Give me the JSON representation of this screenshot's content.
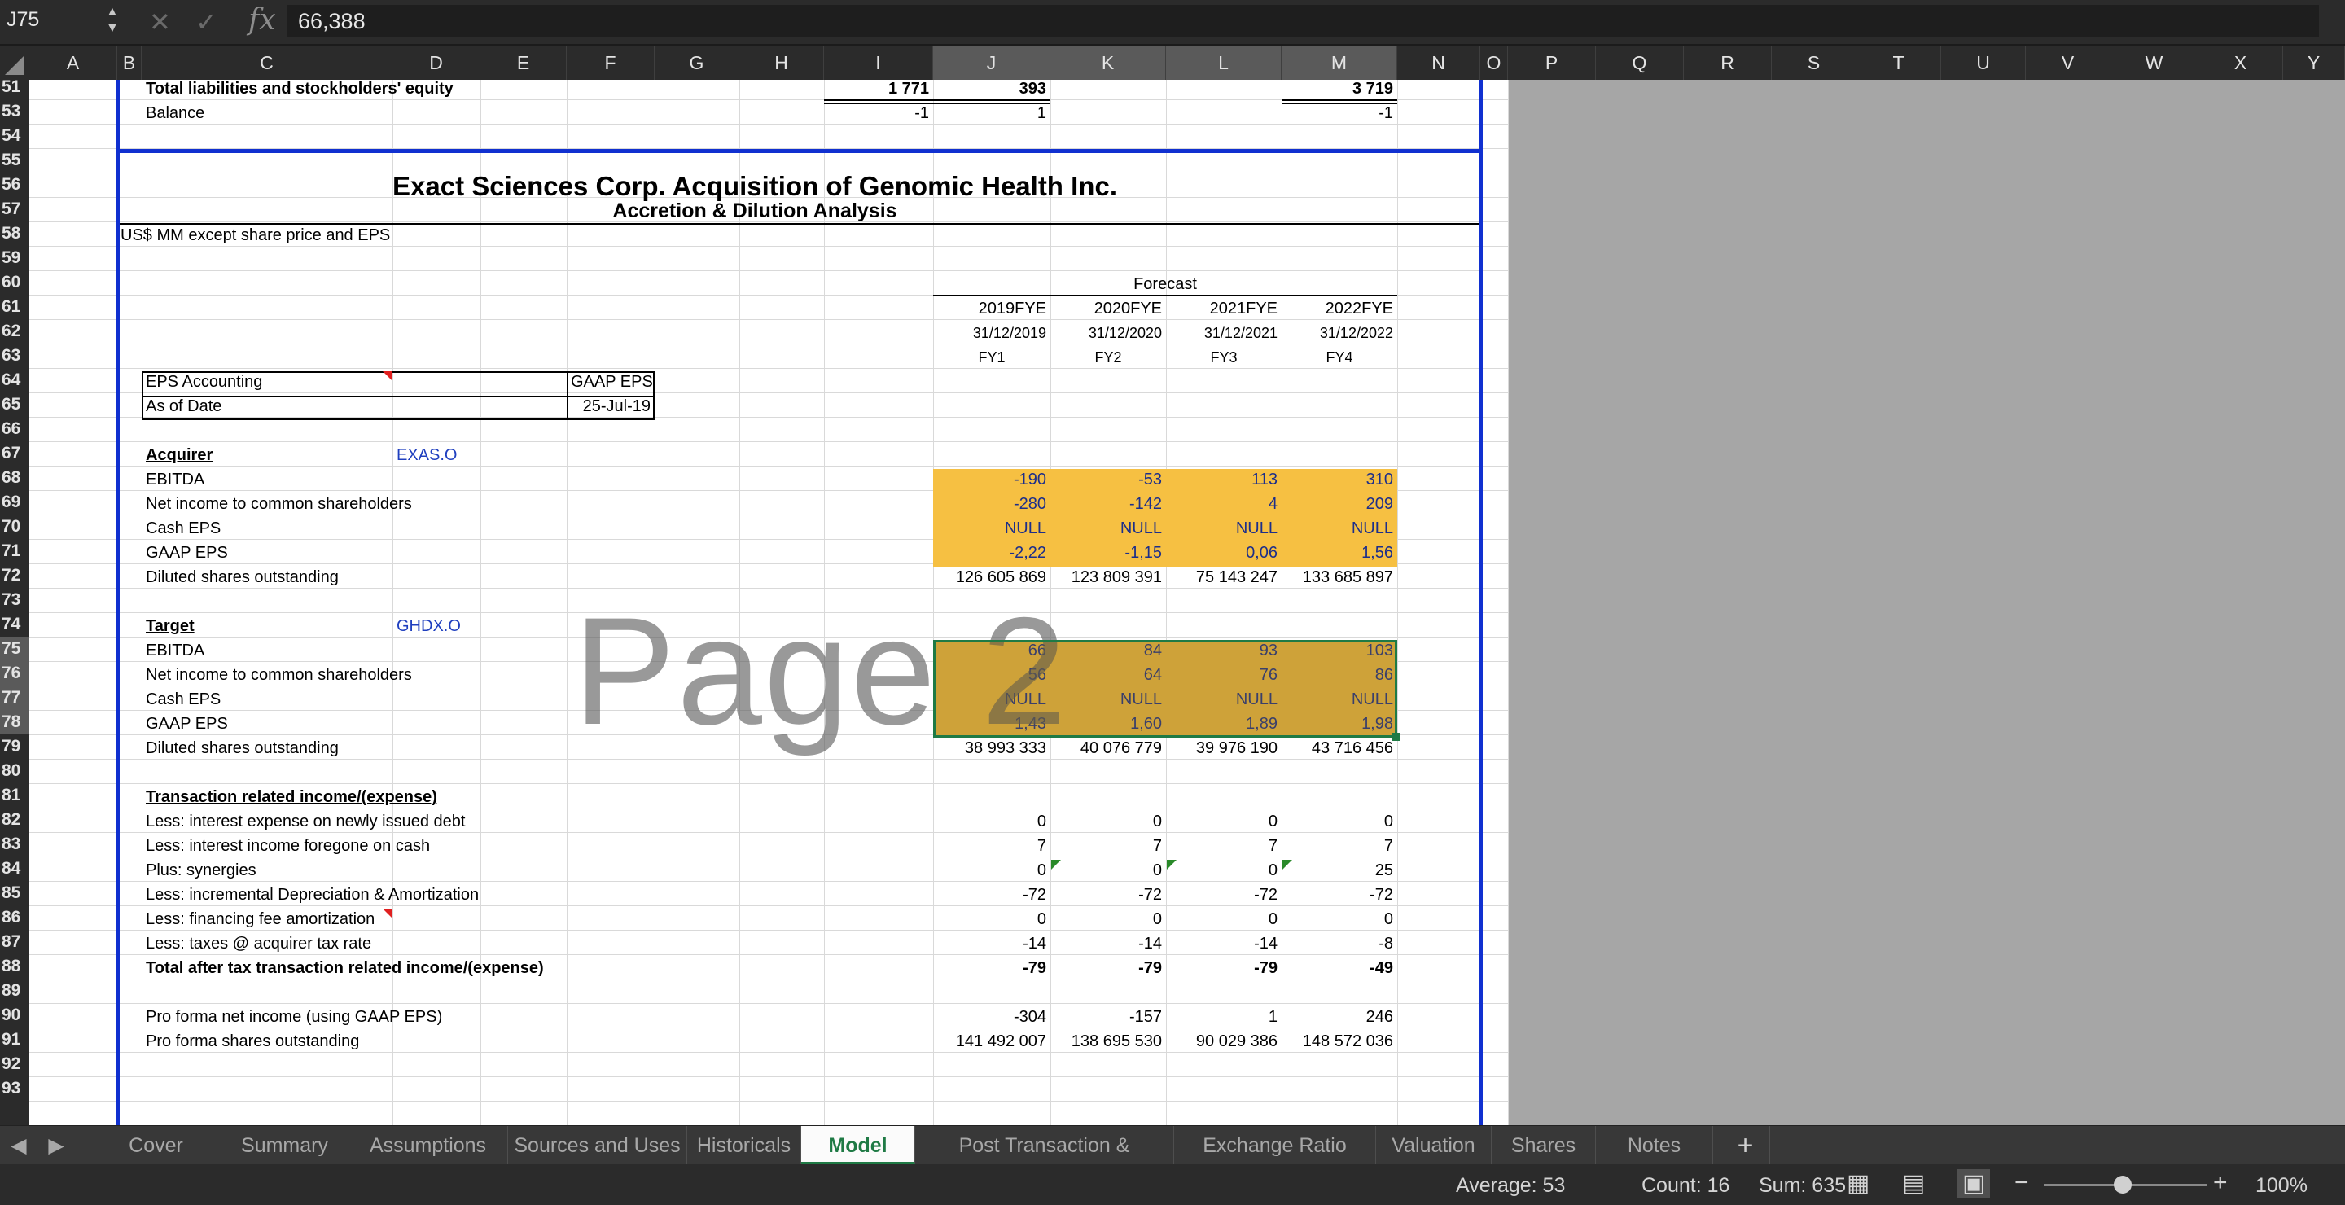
{
  "formula_bar": {
    "cell_ref": "J75",
    "formula": "66,388"
  },
  "columns": [
    "A",
    "B",
    "C",
    "D",
    "E",
    "F",
    "G",
    "H",
    "I",
    "J",
    "K",
    "L",
    "M",
    "N",
    "O",
    "P",
    "Q",
    "R",
    "S",
    "T",
    "U",
    "V",
    "W",
    "X",
    "Y"
  ],
  "rows": [
    "51",
    "53",
    "54",
    "55",
    "56",
    "57",
    "58",
    "59",
    "60",
    "61",
    "62",
    "63",
    "64",
    "65",
    "66",
    "67",
    "68",
    "69",
    "70",
    "71",
    "72",
    "73",
    "74",
    "75",
    "76",
    "77",
    "78",
    "79",
    "80",
    "81",
    "82",
    "83",
    "84",
    "85",
    "86",
    "87",
    "88",
    "89",
    "90",
    "91",
    "92",
    "93"
  ],
  "top": {
    "total_liab_label": "Total liabilities and stockholders' equity",
    "total_liab_i": "1 771",
    "total_liab_j": "393",
    "total_liab_m": "3 719",
    "balance_label": "Balance",
    "balance_i": "-1",
    "balance_j": "1",
    "balance_m": "-1"
  },
  "title": "Exact Sciences Corp. Acquisition of Genomic Health Inc.",
  "subtitle": "Accretion & Dilution Analysis",
  "units_note": "US$ MM except share price and EPS",
  "forecast_label": "Forecast",
  "periods": [
    {
      "fye": "2019FYE",
      "date": "31/12/2019",
      "fy": "FY1"
    },
    {
      "fye": "2020FYE",
      "date": "31/12/2020",
      "fy": "FY2"
    },
    {
      "fye": "2021FYE",
      "date": "31/12/2021",
      "fy": "FY3"
    },
    {
      "fye": "2022FYE",
      "date": "31/12/2022",
      "fy": "FY4"
    }
  ],
  "eps_accounting": {
    "label": "EPS Accounting",
    "value": "GAAP EPS"
  },
  "as_of_date": {
    "label": "As of Date",
    "value": "25-Jul-19"
  },
  "acquirer": {
    "heading": "Acquirer",
    "ticker": "EXAS.O",
    "rows": [
      {
        "label": "EBITDA",
        "values": [
          "-190",
          "-53",
          "113",
          "310"
        ]
      },
      {
        "label": "Net income to common shareholders",
        "values": [
          "-280",
          "-142",
          "4",
          "209"
        ]
      },
      {
        "label": "Cash EPS",
        "values": [
          "NULL",
          "NULL",
          "NULL",
          "NULL"
        ]
      },
      {
        "label": "GAAP EPS",
        "values": [
          "-2,22",
          "-1,15",
          "0,06",
          "1,56"
        ]
      },
      {
        "label": "Diluted shares outstanding",
        "values": [
          "126 605 869",
          "123 809 391",
          "75 143 247",
          "133 685 897"
        ]
      }
    ]
  },
  "target": {
    "heading": "Target",
    "ticker": "GHDX.O",
    "rows": [
      {
        "label": "EBITDA",
        "values": [
          "66",
          "84",
          "93",
          "103"
        ]
      },
      {
        "label": "Net income to common shareholders",
        "values": [
          "56",
          "64",
          "76",
          "86"
        ]
      },
      {
        "label": "Cash EPS",
        "values": [
          "NULL",
          "NULL",
          "NULL",
          "NULL"
        ]
      },
      {
        "label": "GAAP EPS",
        "values": [
          "1,43",
          "1,60",
          "1,89",
          "1,98"
        ]
      },
      {
        "label": "Diluted shares outstanding",
        "values": [
          "38 993 333",
          "40 076 779",
          "39 976 190",
          "43 716 456"
        ]
      }
    ]
  },
  "transaction": {
    "heading": "Transaction related income/(expense)",
    "rows": [
      {
        "label": "Less: interest expense on newly issued debt",
        "values": [
          "0",
          "0",
          "0",
          "0"
        ]
      },
      {
        "label": "Less: interest income foregone on cash",
        "values": [
          "7",
          "7",
          "7",
          "7"
        ]
      },
      {
        "label": "Plus: synergies",
        "values": [
          "0",
          "0",
          "0",
          "25"
        ]
      },
      {
        "label": "Less: incremental Depreciation & Amortization",
        "values": [
          "-72",
          "-72",
          "-72",
          "-72"
        ]
      },
      {
        "label": "Less: financing fee amortization",
        "values": [
          "0",
          "0",
          "0",
          "0"
        ]
      },
      {
        "label": "Less: taxes @ acquirer tax rate",
        "values": [
          "-14",
          "-14",
          "-14",
          "-8"
        ]
      },
      {
        "label": "Total after tax transaction related income/(expense)",
        "values": [
          "-79",
          "-79",
          "-79",
          "-49"
        ]
      }
    ]
  },
  "pro_forma": {
    "rows": [
      {
        "label": "Pro forma net income (using GAAP EPS)",
        "values": [
          "-304",
          "-157",
          "1",
          "246"
        ]
      },
      {
        "label": "Pro forma shares outstanding",
        "values": [
          "141 492 007",
          "138 695 530",
          "90 029 386",
          "148 572 036"
        ]
      }
    ]
  },
  "watermark": "Page 2",
  "tabs": [
    "Cover",
    "Summary",
    "Assumptions",
    "Sources and Uses",
    "Historicals",
    "Model",
    "Post Transaction & Contribution",
    "Exchange Ratio",
    "Valuation",
    "Shares",
    "Notes"
  ],
  "active_tab": "Model",
  "status": {
    "average": "Average: 53",
    "count": "Count: 16",
    "sum": "Sum: 635",
    "zoom": "100%"
  },
  "colors": {
    "highlight_fill": "#f6c042",
    "border_blue": "#1030d0",
    "selection_green": "#1f7a45"
  }
}
